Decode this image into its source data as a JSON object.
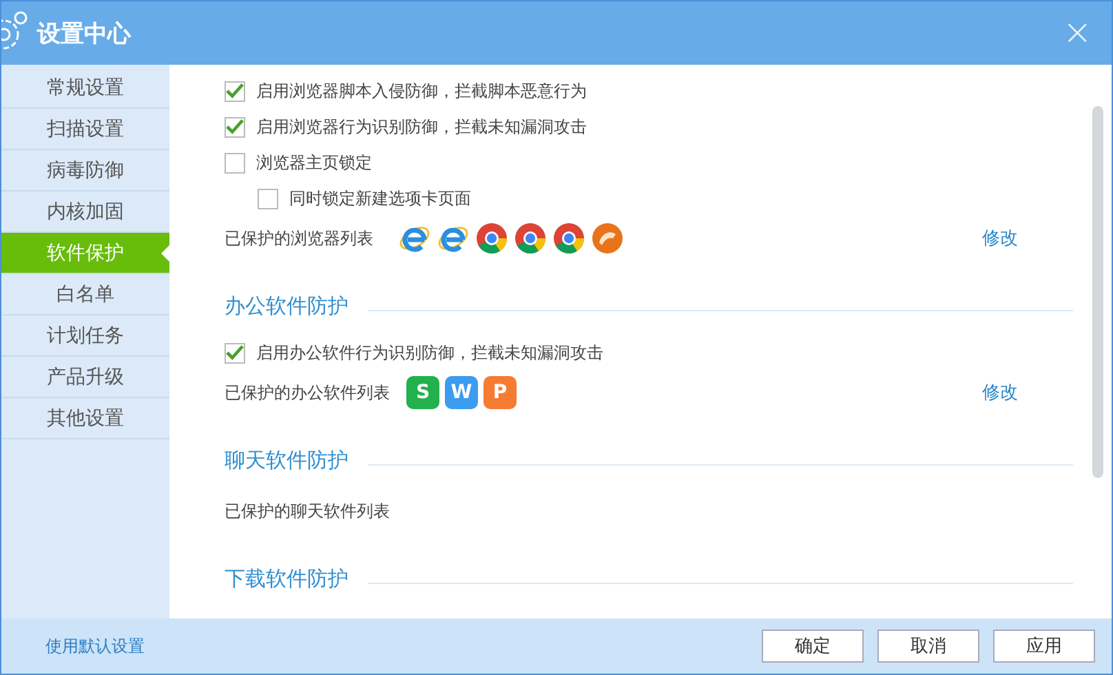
{
  "window": {
    "title": "设置中心",
    "close": "×"
  },
  "sidebar": {
    "items": [
      {
        "label": "常规设置",
        "selected": false
      },
      {
        "label": "扫描设置",
        "selected": false
      },
      {
        "label": "病毒防御",
        "selected": false
      },
      {
        "label": "内核加固",
        "selected": false
      },
      {
        "label": "软件保护",
        "selected": true
      },
      {
        "label": "白名单",
        "selected": false
      },
      {
        "label": "计划任务",
        "selected": false
      },
      {
        "label": "产品升级",
        "selected": false
      },
      {
        "label": "其他设置",
        "selected": false
      }
    ]
  },
  "sections": [
    {
      "rows": [
        {
          "kind": "checkbox",
          "label": "启用浏览器脚本入侵防御，拦截脚本恶意行为",
          "checked": true
        },
        {
          "kind": "checkbox",
          "label": "启用浏览器行为识别防御，拦截未知漏洞攻击",
          "checked": true
        },
        {
          "kind": "checkbox",
          "label": "浏览器主页锁定",
          "checked": false
        },
        {
          "kind": "subcheckbox",
          "label": "同时锁定新建选项卡页面",
          "checked": false
        },
        {
          "kind": "icons",
          "label": "已保护的浏览器列表",
          "link": "修改",
          "icons": [
            {
              "kind": "ie"
            },
            {
              "kind": "ie"
            },
            {
              "kind": "chrome"
            },
            {
              "kind": "chrome"
            },
            {
              "kind": "chrome"
            },
            {
              "kind": "orange"
            }
          ]
        }
      ]
    },
    {
      "title": "办公软件防护",
      "rows": [
        {
          "kind": "checkbox",
          "label": "启用办公软件行为识别防御，拦截未知漏洞攻击",
          "checked": true
        },
        {
          "kind": "apps",
          "label": "已保护的办公软件列表",
          "link": "修改",
          "apps": [
            {
              "letter": "S",
              "color": "#22b14c"
            },
            {
              "letter": "W",
              "color": "#3b9cf0"
            },
            {
              "letter": "P",
              "color": "#f57c32"
            }
          ]
        }
      ]
    },
    {
      "title": "聊天软件防护",
      "rows": [
        {
          "kind": "text",
          "label": "已保护的聊天软件列表"
        }
      ]
    },
    {
      "title": "下载软件防护"
    }
  ],
  "footer": {
    "link": "使用默认设置",
    "buttons": [
      "确定",
      "取消",
      "应用"
    ]
  }
}
